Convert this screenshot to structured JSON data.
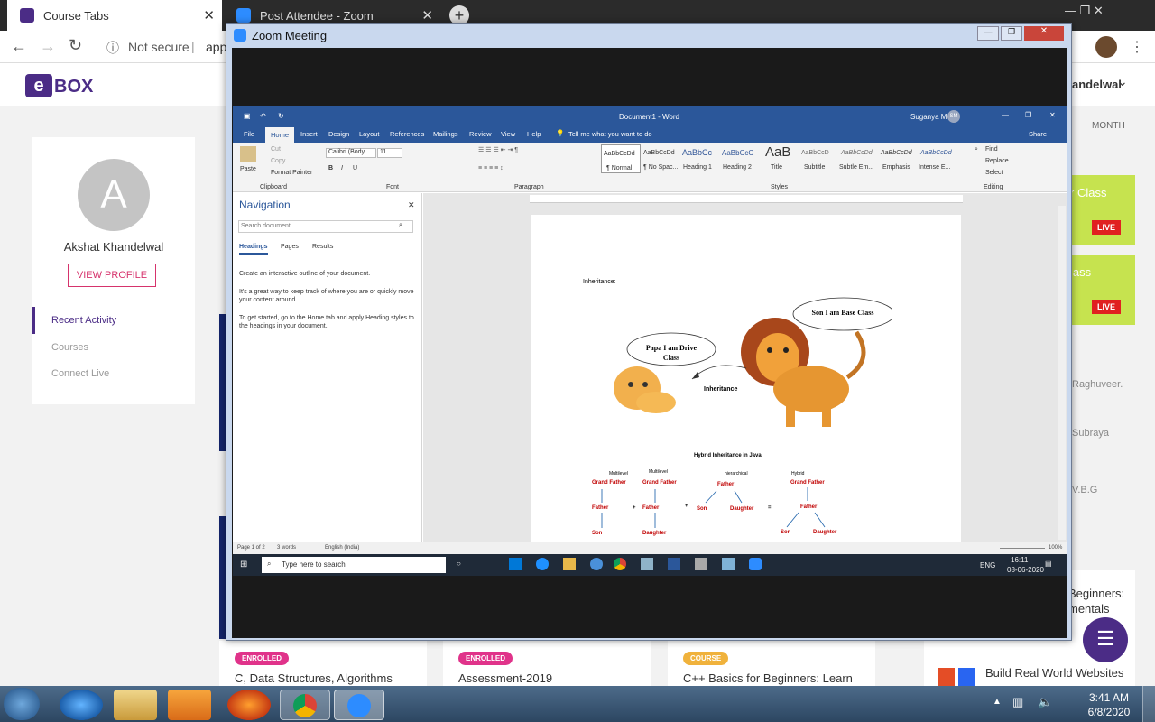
{
  "browser": {
    "tabs": [
      {
        "title": "Course Tabs",
        "active": true
      },
      {
        "title": "Post Attendee - Zoom",
        "active": false
      }
    ],
    "security": "Not secure",
    "url_partial": "app"
  },
  "site": {
    "logo": "BOX",
    "user_menu": "andelwal",
    "profile": {
      "initial": "A",
      "name": "Akshat Khandelwal",
      "button": "VIEW PROFILE"
    },
    "side_nav": [
      "Recent Activity",
      "Courses",
      "Connect Live"
    ],
    "month_label": "MONTH",
    "live_cards": [
      {
        "title_partial": "r Class",
        "badge": "LIVE"
      },
      {
        "title_partial": "lass",
        "badge": "LIVE"
      }
    ],
    "right_names": [
      "Raghuveer.",
      "Subraya",
      "V.B.G"
    ],
    "right_course_partial": [
      "Beginners:",
      "mentals"
    ],
    "courses": [
      {
        "badge": "ENROLLED",
        "title": "C, Data Structures, Algorithms"
      },
      {
        "badge": "ENROLLED",
        "title": "Assessment-2019"
      },
      {
        "badge": "COURSE",
        "title": "C++ Basics for Beginners: Learn"
      },
      {
        "badge": "",
        "title": "Build Real World Websites"
      }
    ]
  },
  "zoom": {
    "title": "Zoom Meeting"
  },
  "word": {
    "doc_title": "Document1 - Word",
    "user": "Suganya M",
    "user_initials": "SM",
    "share": "Share",
    "tabs": [
      "File",
      "Home",
      "Insert",
      "Design",
      "Layout",
      "References",
      "Mailings",
      "Review",
      "View",
      "Help"
    ],
    "tell_me": "Tell me what you want to do",
    "clipboard": {
      "paste": "Paste",
      "cut": "Cut",
      "copy": "Copy",
      "format_painter": "Format Painter",
      "group": "Clipboard"
    },
    "font": {
      "name": "Calibri (Body",
      "size": "11",
      "group": "Font"
    },
    "paragraph_group": "Paragraph",
    "styles": [
      {
        "sample": "AaBbCcDd",
        "name": "¶ Normal"
      },
      {
        "sample": "AaBbCcDd",
        "name": "¶ No Spac..."
      },
      {
        "sample": "AaBbCc",
        "name": "Heading 1"
      },
      {
        "sample": "AaBbCcC",
        "name": "Heading 2"
      },
      {
        "sample": "AaB",
        "name": "Title"
      },
      {
        "sample": "AaBbCcD",
        "name": "Subtitle"
      },
      {
        "sample": "AaBbCcDd",
        "name": "Subtle Em..."
      },
      {
        "sample": "AaBbCcDd",
        "name": "Emphasis"
      },
      {
        "sample": "AaBbCcDd",
        "name": "Intense E..."
      }
    ],
    "styles_group": "Styles",
    "editing": {
      "find": "Find",
      "replace": "Replace",
      "select": "Select",
      "group": "Editing"
    },
    "nav": {
      "title": "Navigation",
      "search_placeholder": "Search document",
      "tabs": [
        "Headings",
        "Pages",
        "Results"
      ],
      "text": [
        "Create an interactive outline of your document.",
        "It's a great way to keep track of where you are or quickly move your content around.",
        "To get started, go to the Home tab and apply Heading styles to the headings in your document."
      ]
    },
    "doc": {
      "heading": "Inheritance:",
      "bubble_son": "Son I am Base Class",
      "bubble_papa": "Papa I am Drive Class",
      "arrow_label": "Inheritance",
      "hybrid_title": "Hybrid Inheritance in Java",
      "diagrams": [
        {
          "kind": "Multilevel",
          "nodes": [
            "Grand Father",
            "Father",
            "Son"
          ]
        },
        {
          "kind": "Multilevel",
          "nodes": [
            "Grand Father",
            "Father",
            "Daughter"
          ]
        },
        {
          "kind": "hierarchical",
          "nodes": [
            "Father",
            "Son",
            "Daughter"
          ]
        },
        {
          "kind": "Hybrid",
          "nodes": [
            "Grand Father",
            "Father",
            "Son",
            "Daughter"
          ]
        }
      ],
      "plus": "+",
      "equals": "="
    },
    "status": {
      "page": "Page 1 of 2",
      "words": "3 words",
      "lang": "English (India)",
      "zoom": "100%"
    },
    "taskbar": {
      "search": "Type here to search",
      "lang": "ENG",
      "time": "16:11",
      "date": "08-06-2020"
    }
  },
  "taskbar": {
    "time": "3:41 AM",
    "date": "6/8/2020"
  }
}
